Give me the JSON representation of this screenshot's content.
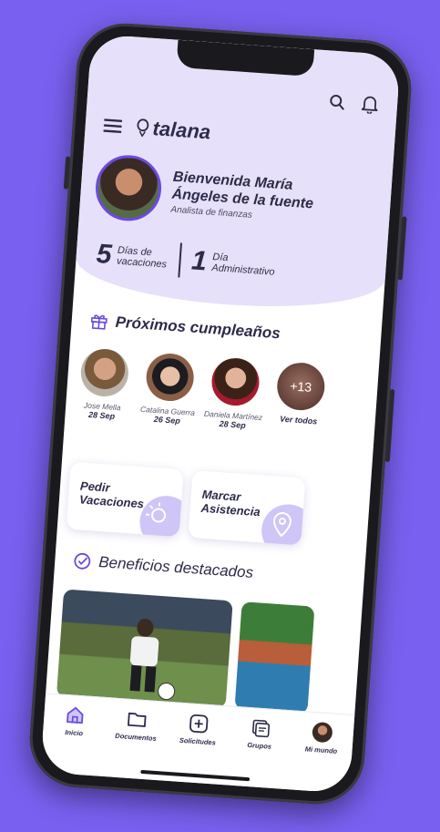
{
  "app": {
    "name": "talana"
  },
  "profile": {
    "greeting": "Bienvenida María Ángeles de la fuente",
    "role": "Analista de finanzas"
  },
  "balances": [
    {
      "value": "5",
      "label": "Días de vacaciones"
    },
    {
      "value": "1",
      "label": "Día Administrativo"
    }
  ],
  "birthdays": {
    "title": "Próximos cumpleaños",
    "people": [
      {
        "name": "Jose Mella",
        "date": "28 Sep"
      },
      {
        "name": "Catalina Guerra",
        "date": "26 Sep"
      },
      {
        "name": "Daniela Martínez",
        "date": "28 Sep"
      }
    ],
    "more_count": "+13",
    "see_all": "Ver todos"
  },
  "actions": {
    "request_vacation": "Pedir Vacaciones",
    "mark_attendance": "Marcar Asistencia"
  },
  "benefits": {
    "title": "Beneficios destacados"
  },
  "bottom_nav": [
    {
      "label": "Inicio",
      "icon": "home-icon"
    },
    {
      "label": "Documentos",
      "icon": "folder-icon"
    },
    {
      "label": "Solicitudes",
      "icon": "plus-icon"
    },
    {
      "label": "Grupos",
      "icon": "group-icon"
    },
    {
      "label": "Mi mundo",
      "icon": "avatar"
    }
  ],
  "colors": {
    "background": "#7a60f0",
    "header": "#e6e0fa",
    "accent": "#6b4ae0",
    "text": "#2d2b4a"
  }
}
